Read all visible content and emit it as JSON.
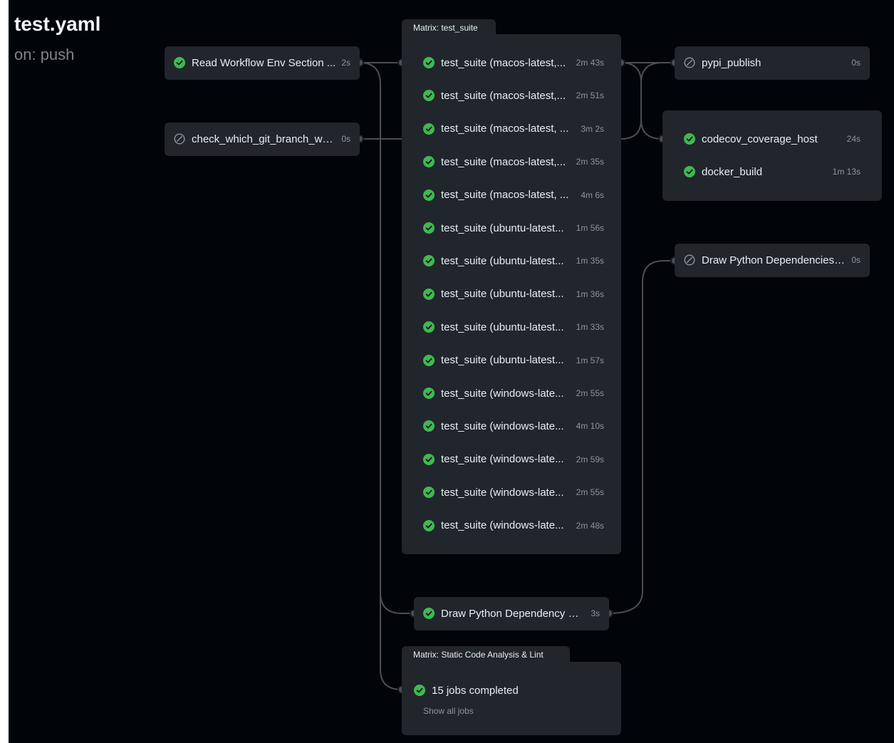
{
  "workflow": {
    "title": "test.yaml",
    "trigger": "on: push"
  },
  "colors": {
    "success": "#3fb950",
    "skipped": "#8b949e",
    "card": "#21262d",
    "canvas": "#010409"
  },
  "jobs": {
    "read_env": {
      "name": "Read Workflow Env Section ...",
      "duration": "2s",
      "status": "success"
    },
    "check_branch": {
      "name": "check_which_git_branch_we...",
      "duration": "0s",
      "status": "skipped"
    },
    "draw_graph": {
      "name": "Draw Python Dependency G...",
      "duration": "3s",
      "status": "success"
    },
    "pypi_publish": {
      "name": "pypi_publish",
      "duration": "0s",
      "status": "skipped"
    },
    "codecov": {
      "name": "codecov_coverage_host",
      "duration": "24s",
      "status": "success"
    },
    "docker_build": {
      "name": "docker_build",
      "duration": "1m 13s",
      "status": "success"
    },
    "draw_deps": {
      "name": "Draw Python Dependencies ...",
      "duration": "0s",
      "status": "skipped"
    }
  },
  "matrix_test_suite": {
    "label": "Matrix: test_suite",
    "jobs": [
      {
        "name": "test_suite (macos-latest,...",
        "duration": "2m 43s",
        "status": "success"
      },
      {
        "name": "test_suite (macos-latest,...",
        "duration": "2m 51s",
        "status": "success"
      },
      {
        "name": "test_suite (macos-latest, ...",
        "duration": "3m 2s",
        "status": "success"
      },
      {
        "name": "test_suite (macos-latest,...",
        "duration": "2m 35s",
        "status": "success"
      },
      {
        "name": "test_suite (macos-latest, ...",
        "duration": "4m 6s",
        "status": "success"
      },
      {
        "name": "test_suite (ubuntu-latest...",
        "duration": "1m 56s",
        "status": "success"
      },
      {
        "name": "test_suite (ubuntu-latest...",
        "duration": "1m 35s",
        "status": "success"
      },
      {
        "name": "test_suite (ubuntu-latest...",
        "duration": "1m 36s",
        "status": "success"
      },
      {
        "name": "test_suite (ubuntu-latest...",
        "duration": "1m 33s",
        "status": "success"
      },
      {
        "name": "test_suite (ubuntu-latest...",
        "duration": "1m 57s",
        "status": "success"
      },
      {
        "name": "test_suite (windows-late...",
        "duration": "2m 55s",
        "status": "success"
      },
      {
        "name": "test_suite (windows-late...",
        "duration": "4m 10s",
        "status": "success"
      },
      {
        "name": "test_suite (windows-late...",
        "duration": "2m 59s",
        "status": "success"
      },
      {
        "name": "test_suite (windows-late...",
        "duration": "2m 55s",
        "status": "success"
      },
      {
        "name": "test_suite (windows-late...",
        "duration": "2m 48s",
        "status": "success"
      }
    ]
  },
  "matrix_lint": {
    "label": "Matrix: Static Code Analysis & Lint",
    "summary": "15 jobs completed",
    "show_all": "Show all jobs",
    "status": "success"
  }
}
